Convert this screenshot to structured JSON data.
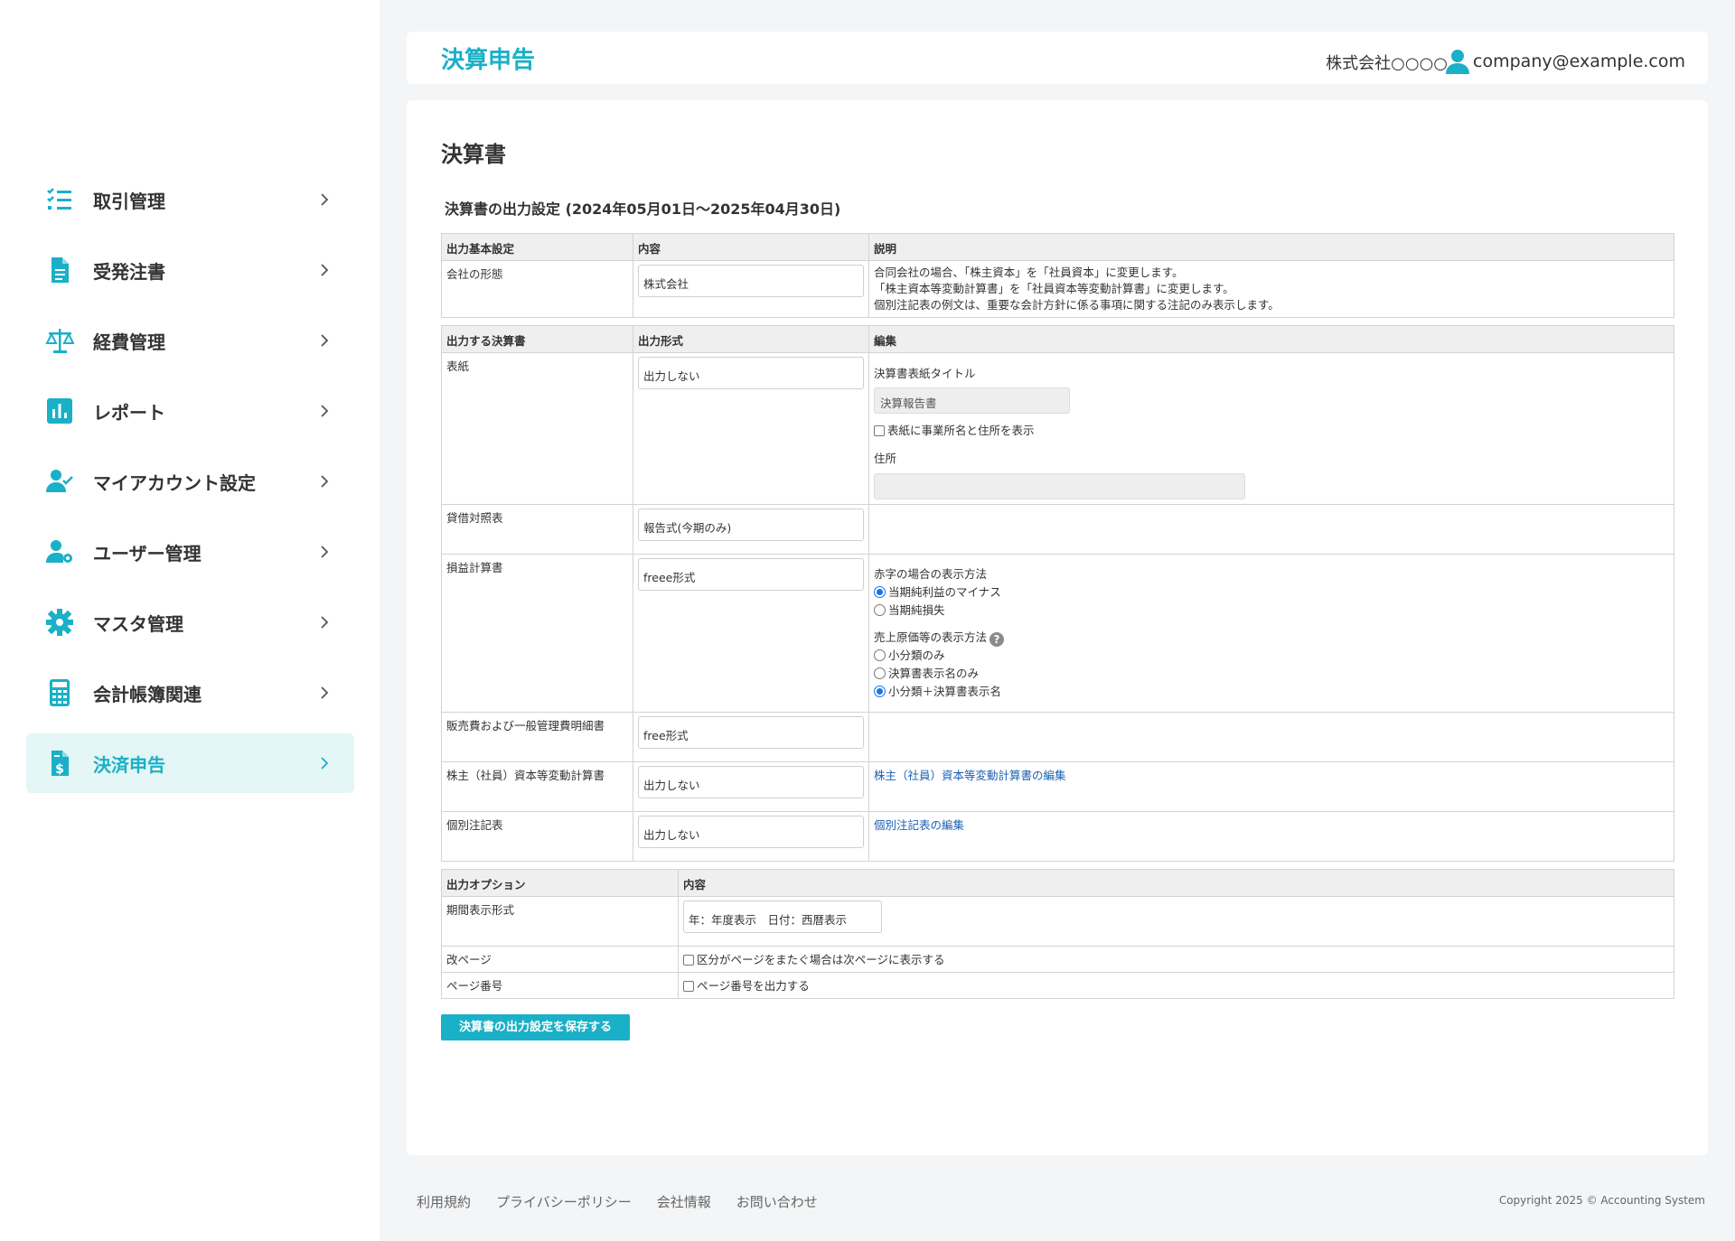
{
  "sidebar": {
    "items": [
      {
        "label": "取引管理",
        "icon": "checklist-icon"
      },
      {
        "label": "受発注書",
        "icon": "document-icon"
      },
      {
        "label": "経費管理",
        "icon": "scale-icon"
      },
      {
        "label": "レポート",
        "icon": "bar-chart-icon"
      },
      {
        "label": "マイアカウント設定",
        "icon": "user-check-icon"
      },
      {
        "label": "ユーザー管理",
        "icon": "user-gear-icon"
      },
      {
        "label": "マスタ管理",
        "icon": "gear-icon"
      },
      {
        "label": "会計帳簿関連",
        "icon": "calculator-icon"
      },
      {
        "label": "決済申告",
        "icon": "invoice-dollar-icon",
        "active": true
      }
    ]
  },
  "header": {
    "title": "決算申告",
    "company": "株式会社○○○○",
    "user_email": "company@example.com"
  },
  "main": {
    "title": "決算書",
    "subtitle": "決算書の出力設定 (2024年05月01日〜2025年04月30日)",
    "basic": {
      "headers": [
        "出力基本設定",
        "内容",
        "説明"
      ],
      "row_label": "会社の形態",
      "row_value": "株式会社",
      "desc": [
        "合同会社の場合、「株主資本」を「社員資本」に変更します。",
        "「株主資本等変動計算書」を「社員資本等変動計算書」に変更します。",
        "個別注記表の例文は、重要な会計方針に係る事項に関する注記のみ表示します。"
      ]
    },
    "statements": {
      "headers": [
        "出力する決算書",
        "出力形式",
        "編集"
      ],
      "cover": {
        "label": "表紙",
        "value": "出力しない",
        "title_label": "決算書表紙タイトル",
        "title_value": "決算報告書",
        "show_address_label": "表紙に事業所名と住所を表示",
        "address_label": "住所",
        "address_value": ""
      },
      "balance": {
        "label": "貸借対照表",
        "value": "報告式(今期のみ)"
      },
      "pl": {
        "label": "損益計算書",
        "value": "freee形式",
        "deficit_label": "赤字の場合の表示方法",
        "deficit_options": [
          "当期純利益のマイナス",
          "当期純損失"
        ],
        "deficit_selected": "当期純利益のマイナス",
        "cogs_label": "売上原価等の表示方法",
        "cogs_options": [
          "小分類のみ",
          "決算書表示名のみ",
          "小分類＋決算書表示名"
        ],
        "cogs_selected": "小分類＋決算書表示名"
      },
      "sga": {
        "label": "販売費および一般管理費明細書",
        "value": "free形式"
      },
      "equity": {
        "label": "株主（社員）資本等変動計算書",
        "value": "出力しない",
        "edit_link": "株主（社員）資本等変動計算書の編集"
      },
      "notes": {
        "label": "個別注記表",
        "value": "出力しない",
        "edit_link": "個別注記表の編集"
      }
    },
    "options": {
      "headers": [
        "出力オプション",
        "内容"
      ],
      "period": {
        "label": "期間表示形式",
        "value": "年：年度表示　日付：西暦表示"
      },
      "pagebreak": {
        "label": "改ページ",
        "check_label": "区分がページをまたぐ場合は次ページに表示する"
      },
      "pagenum": {
        "label": "ページ番号",
        "check_label": "ページ番号を出力する"
      }
    },
    "save_label": "決算書の出力設定を保存する"
  },
  "footer": {
    "links": [
      "利用規約",
      "プライバシーポリシー",
      "会社情報",
      "お問い合わせ"
    ],
    "copyright": "Copyright 2025 © Accounting System"
  },
  "colors": {
    "accent": "#1ab0c7",
    "active_bg": "#e4f6f5",
    "link": "#1a5fb4"
  }
}
